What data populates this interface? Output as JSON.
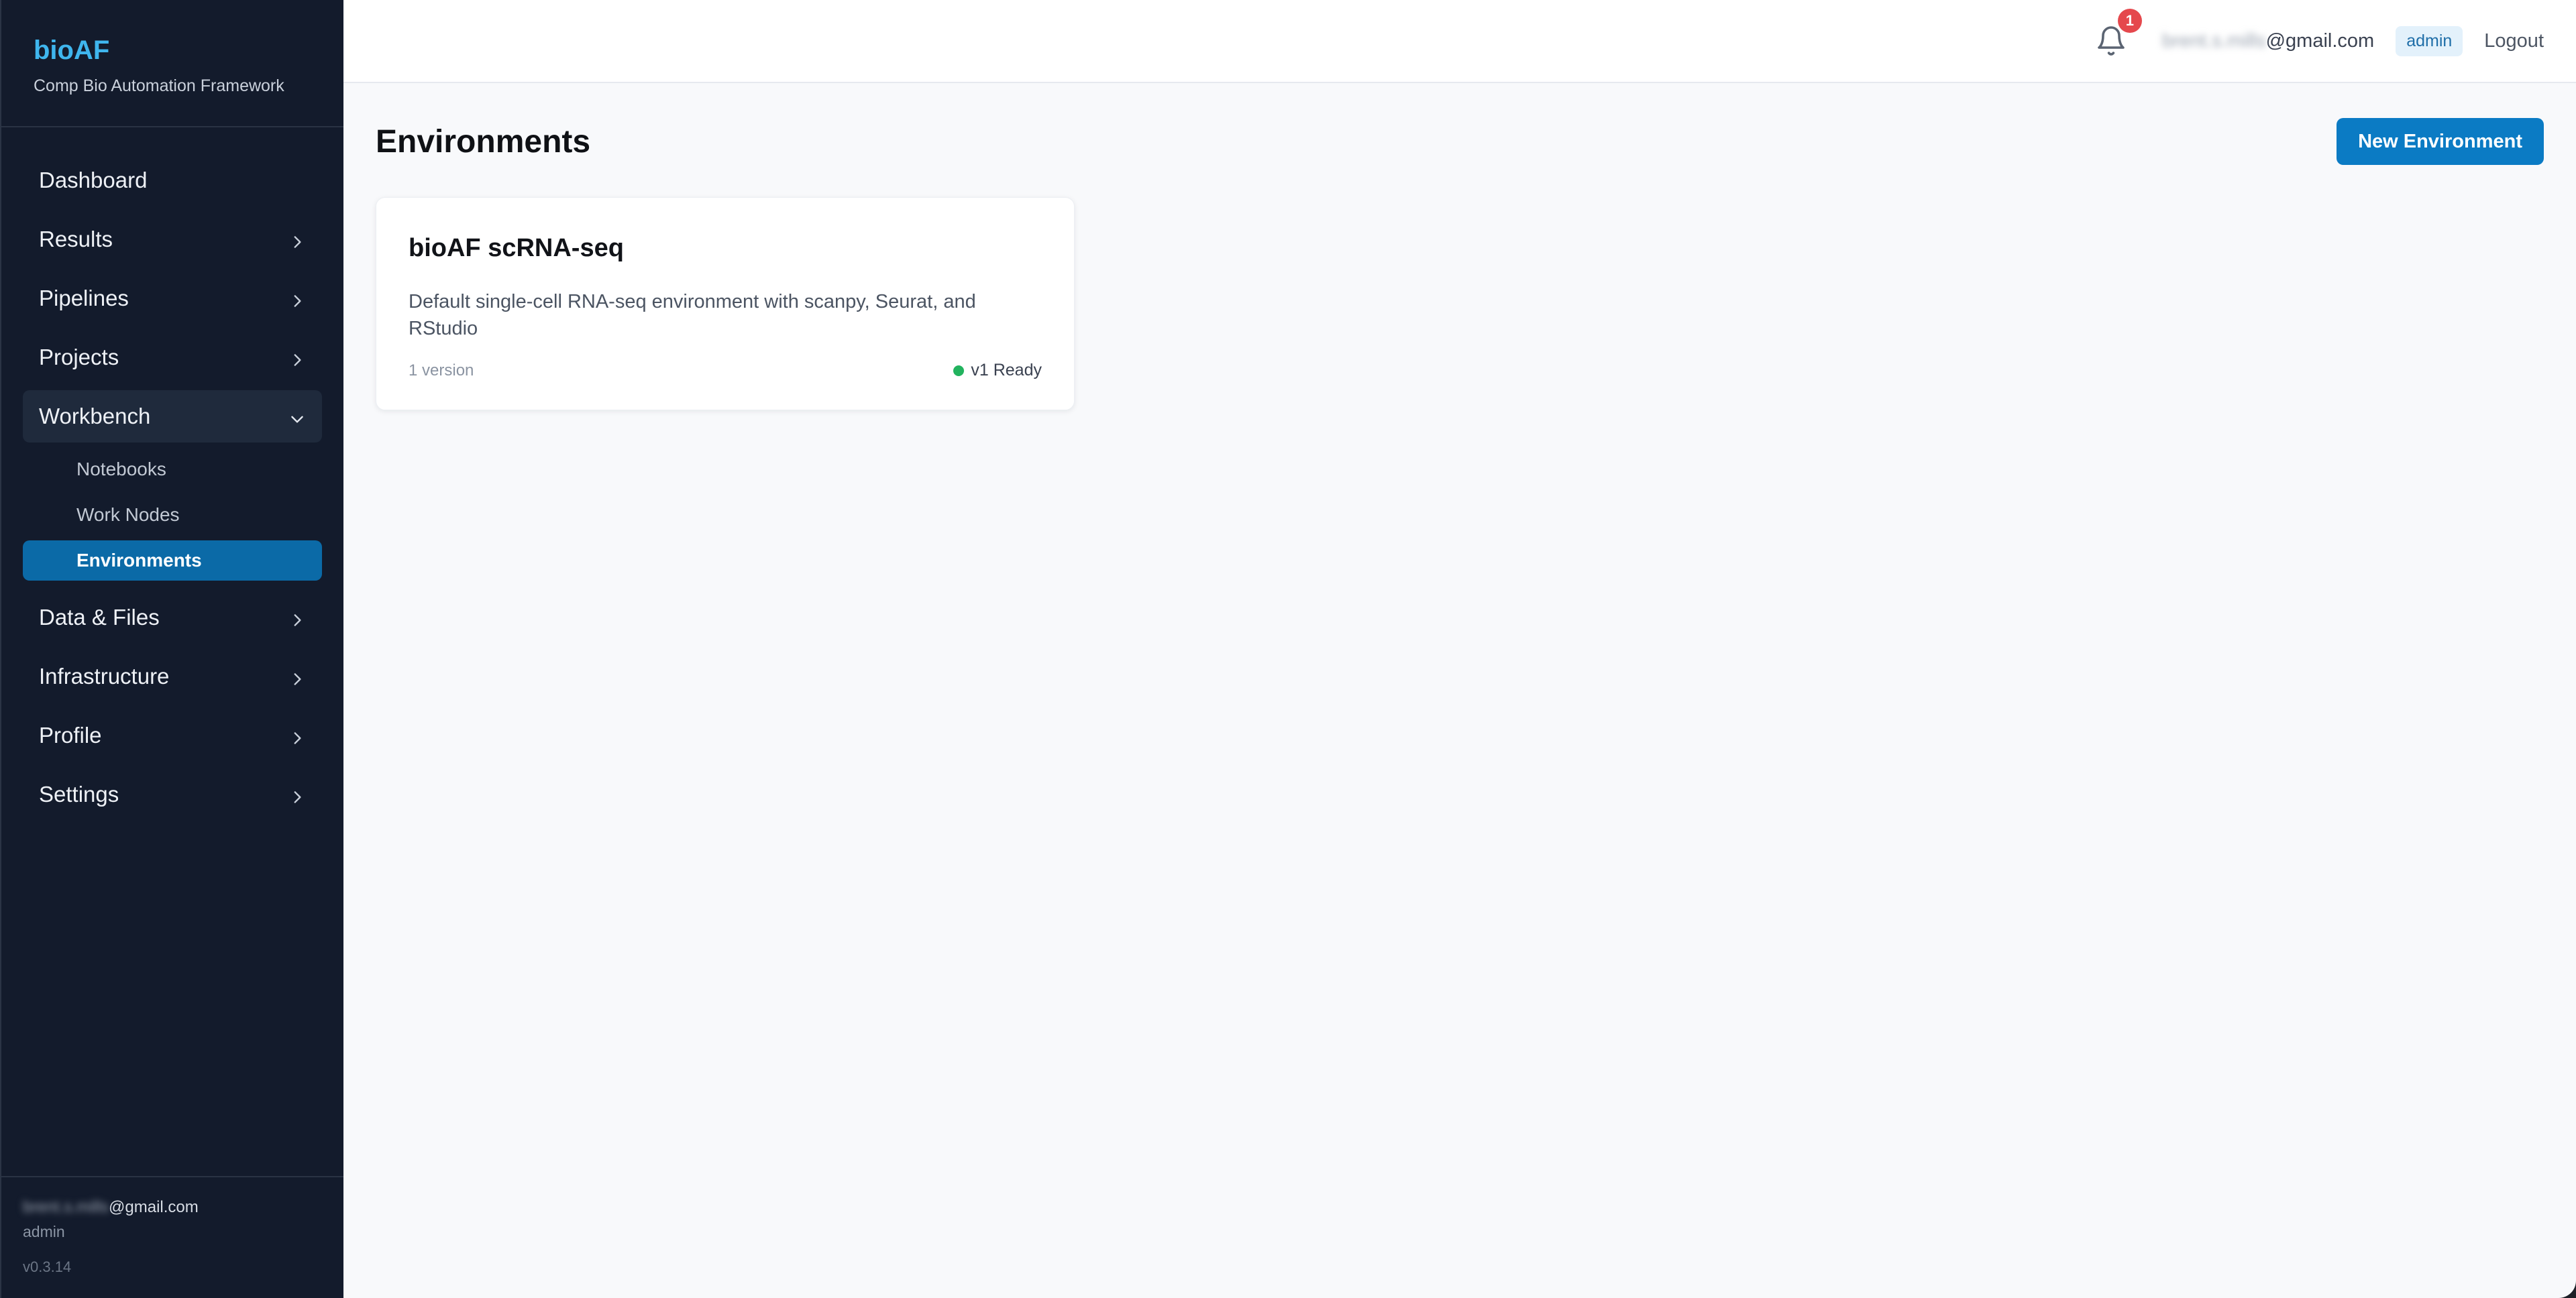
{
  "brand": {
    "title": "bioAF",
    "subtitle": "Comp Bio Automation Framework"
  },
  "sidebar": {
    "items": [
      {
        "label": "Dashboard",
        "icon": null
      },
      {
        "label": "Results",
        "icon": "chevron-right-icon"
      },
      {
        "label": "Pipelines",
        "icon": "chevron-right-icon"
      },
      {
        "label": "Projects",
        "icon": "chevron-right-icon"
      },
      {
        "label": "Workbench",
        "icon": "chevron-down-icon",
        "expanded": true,
        "children": [
          {
            "label": "Notebooks"
          },
          {
            "label": "Work Nodes"
          },
          {
            "label": "Environments",
            "active": true
          }
        ]
      },
      {
        "label": "Data & Files",
        "icon": "chevron-right-icon"
      },
      {
        "label": "Infrastructure",
        "icon": "chevron-right-icon"
      },
      {
        "label": "Profile",
        "icon": "chevron-right-icon"
      },
      {
        "label": "Settings",
        "icon": "chevron-right-icon"
      }
    ],
    "footer": {
      "email_hidden": "brent.s.mills",
      "email_domain": "@gmail.com",
      "role": "admin",
      "version": "v0.3.14"
    }
  },
  "topbar": {
    "notification_count": "1",
    "email_hidden": "brent.s.mills",
    "email_domain": "@gmail.com",
    "role": "admin",
    "logout_label": "Logout"
  },
  "page": {
    "title": "Environments",
    "new_button_label": "New Environment"
  },
  "environments": [
    {
      "name": "bioAF scRNA-seq",
      "description": "Default single-cell RNA-seq environment with scanpy, Seurat, and RStudio",
      "version_count": "1 version",
      "status": "v1 Ready",
      "status_color": "#22b35e"
    }
  ],
  "colors": {
    "accent": "#0b7bc4",
    "sidebar_bg": "#131b2c",
    "brand": "#3fb6ee",
    "badge": "#e5484d"
  }
}
